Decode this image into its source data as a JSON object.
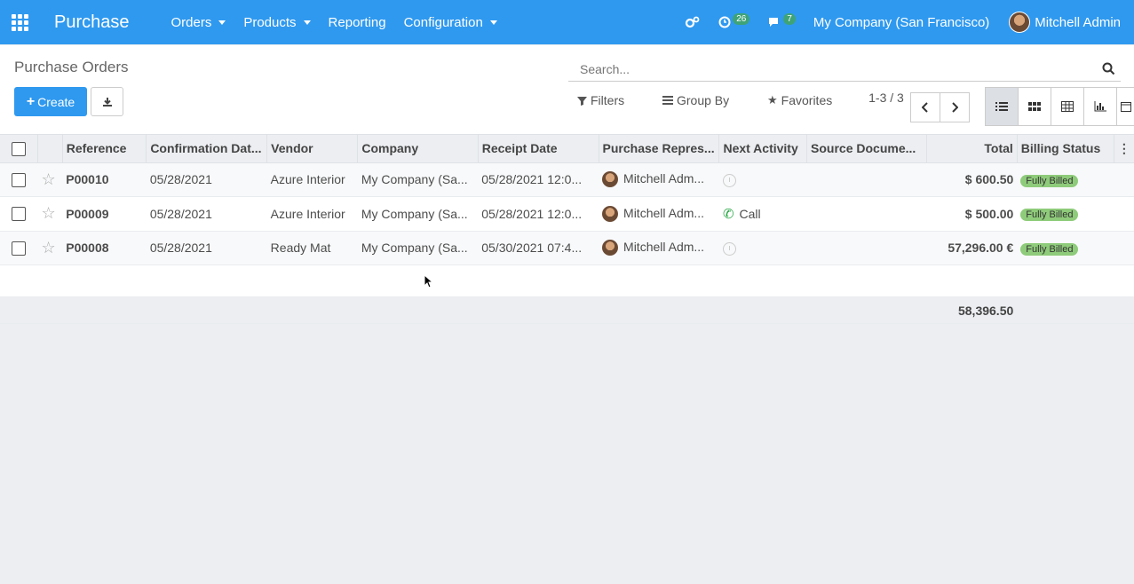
{
  "navbar": {
    "brand": "Purchase",
    "menu": [
      {
        "label": "Orders",
        "dropdown": true
      },
      {
        "label": "Products",
        "dropdown": true
      },
      {
        "label": "Reporting",
        "dropdown": false
      },
      {
        "label": "Configuration",
        "dropdown": true
      }
    ],
    "activity_count": "26",
    "message_count": "7",
    "company": "My Company (San Francisco)",
    "user": "Mitchell Admin",
    "accent_color": "#2f99ef"
  },
  "control_panel": {
    "title": "Purchase Orders",
    "create_label": "Create",
    "search_placeholder": "Search...",
    "filters_label": "Filters",
    "group_by_label": "Group By",
    "favorites_label": "Favorites",
    "pager_value": "1-3 / 3"
  },
  "table": {
    "columns": [
      "Reference",
      "Confirmation Dat...",
      "Vendor",
      "Company",
      "Receipt Date",
      "Purchase Repres...",
      "Next Activity",
      "Source Docume...",
      "Total",
      "Billing Status"
    ],
    "rows": [
      {
        "reference": "P00010",
        "confirmation": "05/28/2021",
        "vendor": "Azure Interior",
        "company": "My Company (Sa...",
        "receipt": "05/28/2021 12:0...",
        "rep": "Mitchell Adm...",
        "activity": "",
        "source": "",
        "total": "$ 600.50",
        "billing": "Fully Billed"
      },
      {
        "reference": "P00009",
        "confirmation": "05/28/2021",
        "vendor": "Azure Interior",
        "company": "My Company (Sa...",
        "receipt": "05/28/2021 12:0...",
        "rep": "Mitchell Adm...",
        "activity": "Call",
        "source": "",
        "total": "$ 500.00",
        "billing": "Fully Billed"
      },
      {
        "reference": "P00008",
        "confirmation": "05/28/2021",
        "vendor": "Ready Mat",
        "company": "My Company (Sa...",
        "receipt": "05/30/2021 07:4...",
        "rep": "Mitchell Adm...",
        "activity": "",
        "source": "",
        "total": "57,296.00 €",
        "billing": "Fully Billed"
      }
    ],
    "grand_total": "58,396.50"
  }
}
